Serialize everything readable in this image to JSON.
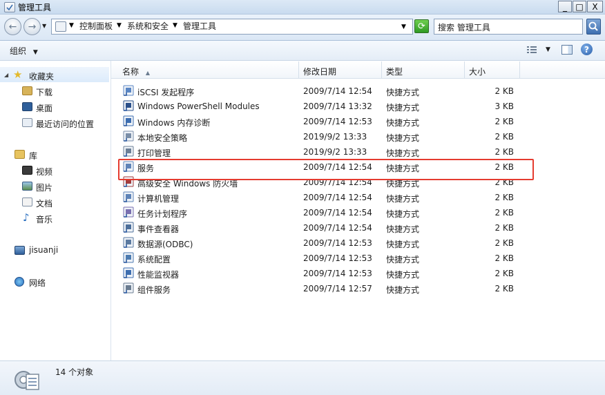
{
  "window": {
    "title": "管理工具"
  },
  "caption_buttons": {
    "min": "_",
    "max": "□",
    "close": "X"
  },
  "nav": {
    "back": "←",
    "forward": "→",
    "breadcrumb": [
      "控制面板",
      "系统和安全",
      "管理工具"
    ],
    "refresh": "⟳",
    "search_label": "搜索 管理工具"
  },
  "commandbar": {
    "organize": "组织"
  },
  "sidebar": {
    "favorites": {
      "label": "收藏夹",
      "items": [
        "下载",
        "桌面",
        "最近访问的位置"
      ]
    },
    "libraries": {
      "label": "库",
      "items": [
        "视频",
        "图片",
        "文档",
        "音乐"
      ]
    },
    "computer": "jisuanji",
    "network": "网络"
  },
  "columns": {
    "name": "名称",
    "date": "修改日期",
    "type": "类型",
    "size": "大小"
  },
  "files": [
    {
      "name": "iSCSI 发起程序",
      "date": "2009/7/14 12:54",
      "type": "快捷方式",
      "size": "2 KB"
    },
    {
      "name": "Windows PowerShell Modules",
      "date": "2009/7/14 13:32",
      "type": "快捷方式",
      "size": "3 KB"
    },
    {
      "name": "Windows 内存诊断",
      "date": "2009/7/14 12:53",
      "type": "快捷方式",
      "size": "2 KB"
    },
    {
      "name": "本地安全策略",
      "date": "2019/9/2 13:33",
      "type": "快捷方式",
      "size": "2 KB"
    },
    {
      "name": "打印管理",
      "date": "2019/9/2 13:33",
      "type": "快捷方式",
      "size": "2 KB"
    },
    {
      "name": "服务",
      "date": "2009/7/14 12:54",
      "type": "快捷方式",
      "size": "2 KB"
    },
    {
      "name": "高级安全 Windows 防火墙",
      "date": "2009/7/14 12:54",
      "type": "快捷方式",
      "size": "2 KB"
    },
    {
      "name": "计算机管理",
      "date": "2009/7/14 12:54",
      "type": "快捷方式",
      "size": "2 KB"
    },
    {
      "name": "任务计划程序",
      "date": "2009/7/14 12:54",
      "type": "快捷方式",
      "size": "2 KB"
    },
    {
      "name": "事件查看器",
      "date": "2009/7/14 12:54",
      "type": "快捷方式",
      "size": "2 KB"
    },
    {
      "name": "数据源(ODBC)",
      "date": "2009/7/14 12:53",
      "type": "快捷方式",
      "size": "2 KB"
    },
    {
      "name": "系统配置",
      "date": "2009/7/14 12:53",
      "type": "快捷方式",
      "size": "2 KB"
    },
    {
      "name": "性能监视器",
      "date": "2009/7/14 12:53",
      "type": "快捷方式",
      "size": "2 KB"
    },
    {
      "name": "组件服务",
      "date": "2009/7/14 12:57",
      "type": "快捷方式",
      "size": "2 KB"
    }
  ],
  "status": {
    "count": "14 个对象"
  },
  "colors": {
    "highlight": "#e53b2f",
    "accent": "#3d6eb0"
  }
}
